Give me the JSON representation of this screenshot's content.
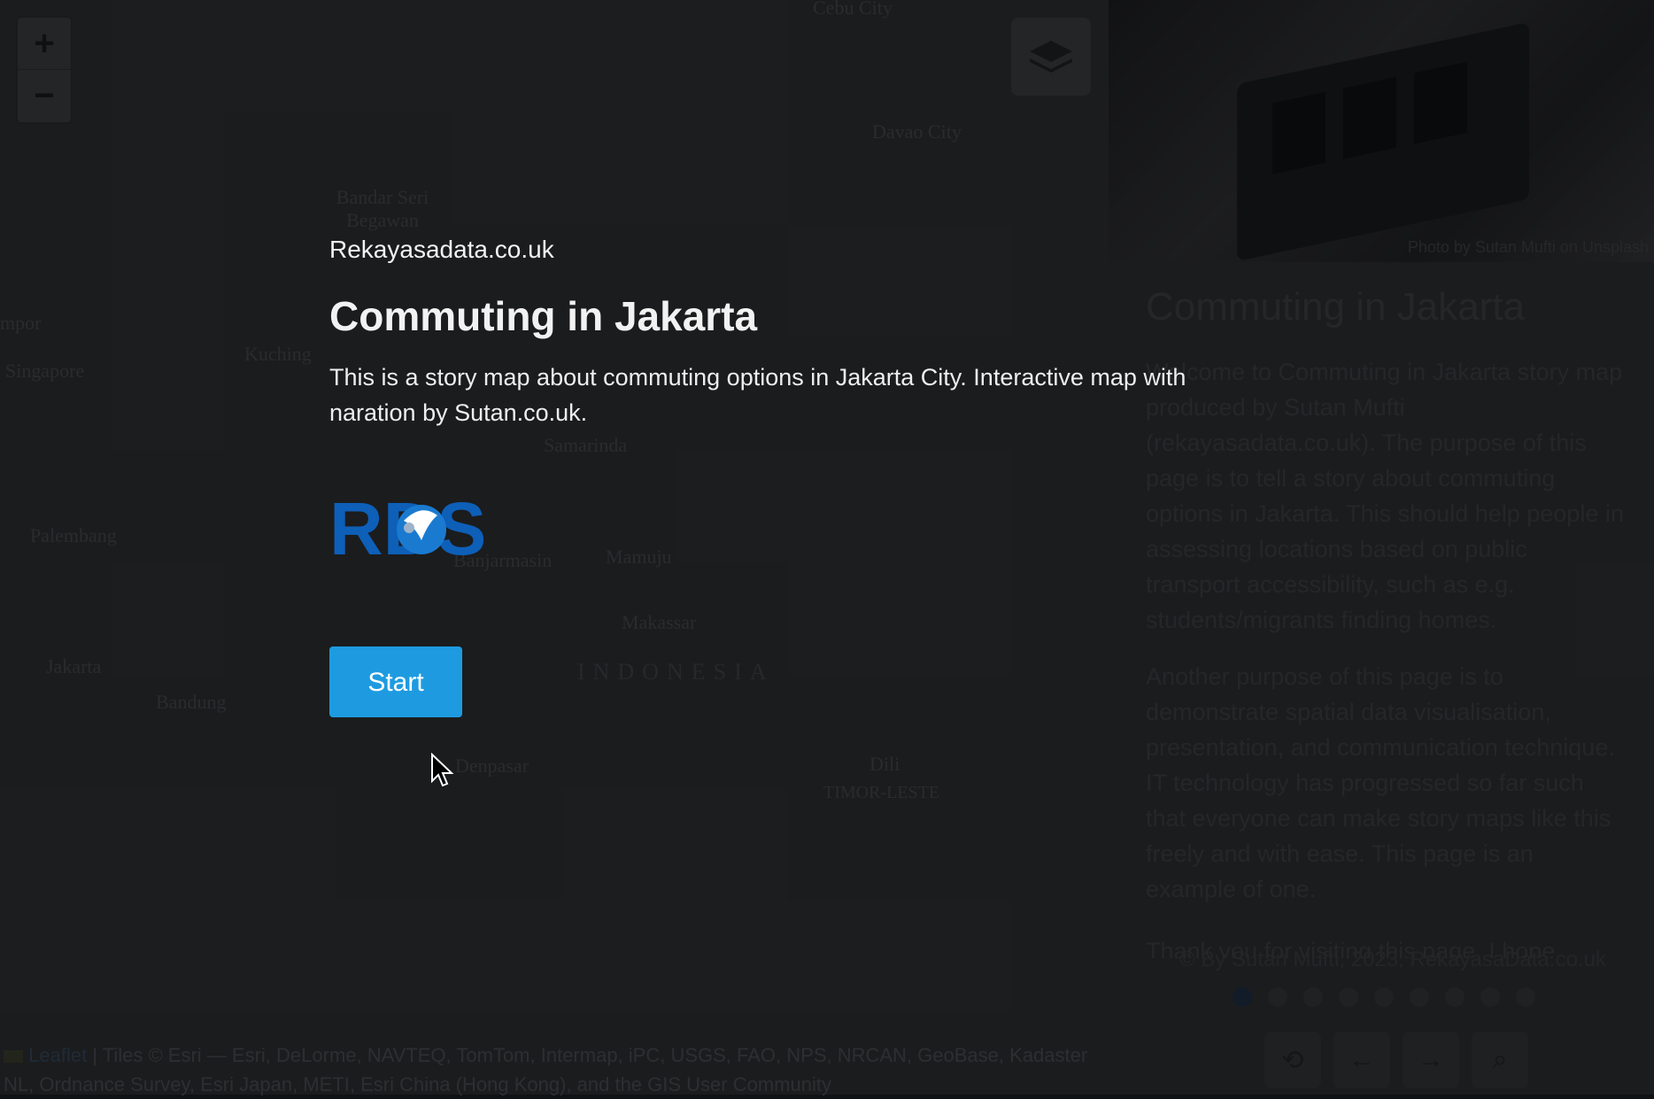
{
  "map": {
    "labels": [
      "Cebu City",
      "Davao City",
      "Bandar Seri Begawan",
      "Kuching",
      "Singapore",
      "mpor",
      "Palembang",
      "Jakarta",
      "Bandung",
      "Samarinda",
      "Mamuju",
      "Makassar",
      "INDONESIA",
      "Denpasar",
      "Dili",
      "TIMOR-LESTE",
      "Banjarmasin"
    ],
    "zoom_in": "+",
    "zoom_out": "−"
  },
  "attribution": {
    "leaflet": "Leaflet",
    "text": " | Tiles © Esri — Esri, DeLorme, NAVTEQ, TomTom, Intermap, iPC, USGS, FAO, NPS, NRCAN, GeoBase, Kadaster NL, Ordnance Survey, Esri Japan, METI, Esri China (Hong Kong), and the GIS User Community"
  },
  "panel": {
    "photo_credit": "Photo by Sutan Mufti on Unsplash",
    "title": "Commuting in Jakarta",
    "paragraphs": [
      "Welcome to Commuting in Jakarta story map produced by Sutan Mufti (rekayasadata.co.uk). The purpose of this page is to tell a story about commuting options in Jakarta. This should help people in assessing locations based on public transport accessibility, such as e.g. students/migrants finding homes.",
      "Another purpose of this page is to demonstrate spatial data visualisation, presentation, and communication technique. IT technology has progressed so far such that everyone can make story maps like this freely and with ease. This page is an example of one.",
      "Thank you for visiting this page. I hope"
    ],
    "copyright": "© By Sutan Mufti, 2023, RekayasaData.co.uk",
    "nav_icons": [
      "home-icon",
      "back-icon",
      "forward-icon",
      "search-icon"
    ]
  },
  "splash": {
    "site": "Rekayasadata.co.uk",
    "title": "Commuting in Jakarta",
    "description": "This is a story map about commuting options in Jakarta City. Interactive map with naration by Sutan.co.uk.",
    "logo_text": "RDS",
    "start_label": "Start"
  },
  "colors": {
    "accent": "#1e9be0",
    "logo_blue": "#0d5fb8"
  }
}
